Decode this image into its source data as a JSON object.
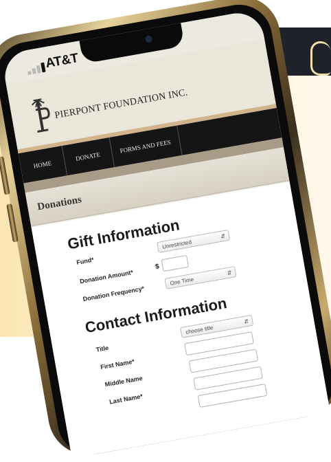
{
  "status_bar": {
    "carrier": "AT&T"
  },
  "site": {
    "org_name": "PIERPONT FOUNDATION INC."
  },
  "nav": {
    "items": [
      "HOME",
      "DONATE",
      "FORMS AND FEES"
    ]
  },
  "page": {
    "section_title": "Donations"
  },
  "gift": {
    "heading": "Gift Information",
    "fund_label": "Fund*",
    "fund_value": "Unrestricted",
    "amount_label": "Donation Amount*",
    "currency_symbol": "$",
    "frequency_label": "Donation Frequency*",
    "frequency_value": "One Time"
  },
  "contact": {
    "heading": "Contact Information",
    "title_label": "Title",
    "title_value": "choose title",
    "first_name_label": "First Name*",
    "middle_name_label": "Middle Name",
    "last_name_label": "Last Name*"
  },
  "colors": {
    "background_cream": "#fbe6b3",
    "phone_gold": "#c9ab6e",
    "nav_bg": "#151515"
  }
}
